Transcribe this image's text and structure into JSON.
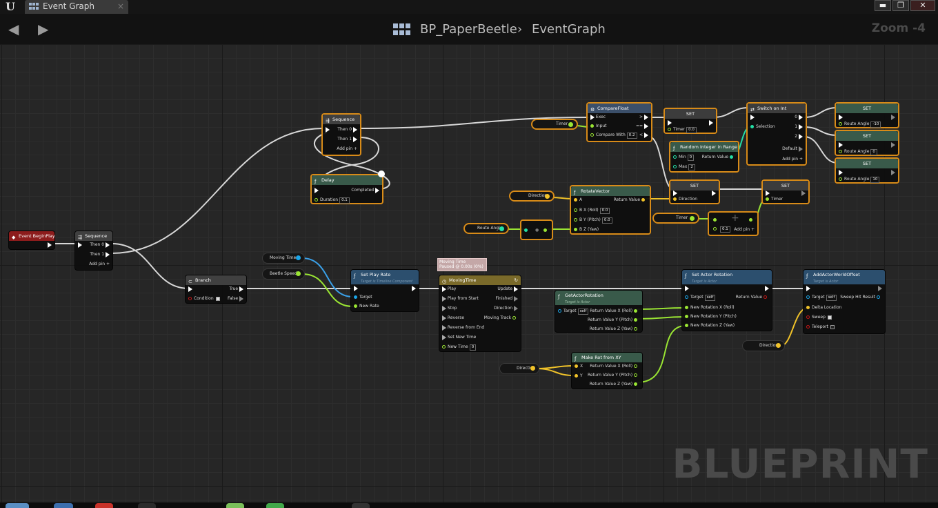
{
  "titlebar": {
    "tab_label": "Event Graph",
    "tab_close": "×",
    "buttons": {
      "minimize": "▬",
      "maximize": "❐",
      "close": "✕"
    }
  },
  "breadcrumb": {
    "blueprint": "BP_PaperBeetle",
    "separator": "›",
    "graph": "EventGraph",
    "zoom": "Zoom -4"
  },
  "watermark": "BLUEPRINT",
  "colors": {
    "event": "#8c1c1c",
    "flow": "#3a3a3a",
    "function": "#395a4a",
    "target": "#2c4f6e",
    "compare": "#3b4f6a",
    "timeline": "#7a6a2a",
    "float_pin": "#9ae533",
    "vector_pin": "#f0c229",
    "object_pin": "#1aa5e8",
    "int_pin": "#24dfa5",
    "bool_pin": "#9b0d0d",
    "selection": "#d88b18"
  },
  "nodes": {
    "event_begin_play": {
      "title": "Event BeginPlay"
    },
    "sequence_main": {
      "title": "Sequence",
      "then0": "Then 0",
      "then1": "Then 1",
      "add_pin": "Add pin"
    },
    "sequence_top": {
      "title": "Sequence",
      "then0": "Then 0",
      "then1": "Then 1",
      "add_pin": "Add pin"
    },
    "delay": {
      "title": "Delay",
      "completed": "Completed",
      "duration_label": "Duration",
      "duration": "0.1"
    },
    "branch": {
      "title": "Branch",
      "true": "True",
      "false": "False",
      "condition": "Condition"
    },
    "set_play_rate": {
      "title": "Set Play Rate",
      "subtitle": "Target is Timeline Component",
      "target": "Target",
      "new_rate": "New Rate"
    },
    "moving_time": {
      "title": "MovingTime",
      "comment_line1": "Moving Time",
      "comment_line2": "Paused @ 0.00s (0%)",
      "inputs": [
        "Play",
        "Play from Start",
        "Stop",
        "Reverse",
        "Reverse from End",
        "Set New Time"
      ],
      "new_time_label": "New Time",
      "new_time": "0",
      "outputs": [
        "Update",
        "Finished",
        "Direction",
        "Moving Track"
      ]
    },
    "compare_float": {
      "title": "CompareFloat",
      "exec": "Exec",
      "input": "Input",
      "compare_with_label": "Compare With",
      "compare_with": "0.2",
      "gt": ">",
      "eq": "==",
      "lt": "<"
    },
    "set_timer_top": {
      "title": "SET",
      "timer_label": "Timer",
      "timer": "0.0"
    },
    "random_int": {
      "title": "Random Integer in Range",
      "min_label": "Min",
      "min": "0",
      "max_label": "Max",
      "max": "2",
      "return": "Return Value"
    },
    "switch_int": {
      "title": "Switch on Int",
      "selection": "Selection",
      "outs": [
        "0",
        "1",
        "2"
      ],
      "default": "Default",
      "add_pin": "Add pin"
    },
    "set_route_a": {
      "title": "SET",
      "label": "Route Angle",
      "value": "-10"
    },
    "set_route_b": {
      "title": "SET",
      "label": "Route Angle",
      "value": "0"
    },
    "set_route_c": {
      "title": "SET",
      "label": "Route Angle",
      "value": "10"
    },
    "rotate_vector": {
      "title": "RotateVector",
      "a": "A",
      "bx_label": "B X (Roll)",
      "bx": "0.0",
      "by_label": "B Y (Pitch)",
      "by": "0.0",
      "bz": "B Z (Yaw)",
      "return": "Return Value"
    },
    "set_direction": {
      "title": "SET",
      "label": "Direction"
    },
    "set_timer_bottom": {
      "title": "SET",
      "label": "Timer"
    },
    "add_float": {
      "value": "0.1",
      "add_pin": "Add pin"
    },
    "get_actor_rotation": {
      "title": "GetActorRotation",
      "subtitle": "Target is Actor",
      "target": "Target",
      "target_val": "self",
      "rx": "Return Value X (Roll)",
      "ry": "Return Value Y (Pitch)",
      "rz": "Return Value Z (Yaw)"
    },
    "set_actor_rotation": {
      "title": "Set Actor Rotation",
      "subtitle": "Target is Actor",
      "target": "Target",
      "target_val": "self",
      "nx": "New Rotation X (Roll)",
      "ny": "New Rotation Y (Pitch)",
      "nz": "New Rotation Z (Yaw)",
      "return": "Return Value"
    },
    "make_rot": {
      "title": "Make Rot from XY",
      "x": "X",
      "y": "Y",
      "rx": "Return Value X (Roll)",
      "ry": "Return Value Y (Pitch)",
      "rz": "Return Value Z (Yaw)"
    },
    "add_offset": {
      "title": "AddActorWorldOffset",
      "subtitle": "Target is Actor",
      "target": "Target",
      "target_val": "self",
      "delta": "Delta Location",
      "sweep": "Sweep",
      "teleport": "Teleport",
      "sweep_hit": "Sweep Hit Result"
    }
  },
  "variables": {
    "moving_time": "Moving Time",
    "beetle_speed": "Beetle Speed",
    "timer_a": "Timer",
    "timer_b": "Timer",
    "direction_a": "Direction",
    "direction_b": "Direction",
    "direction_c": "Direction",
    "route_angle": "Route Angle"
  }
}
